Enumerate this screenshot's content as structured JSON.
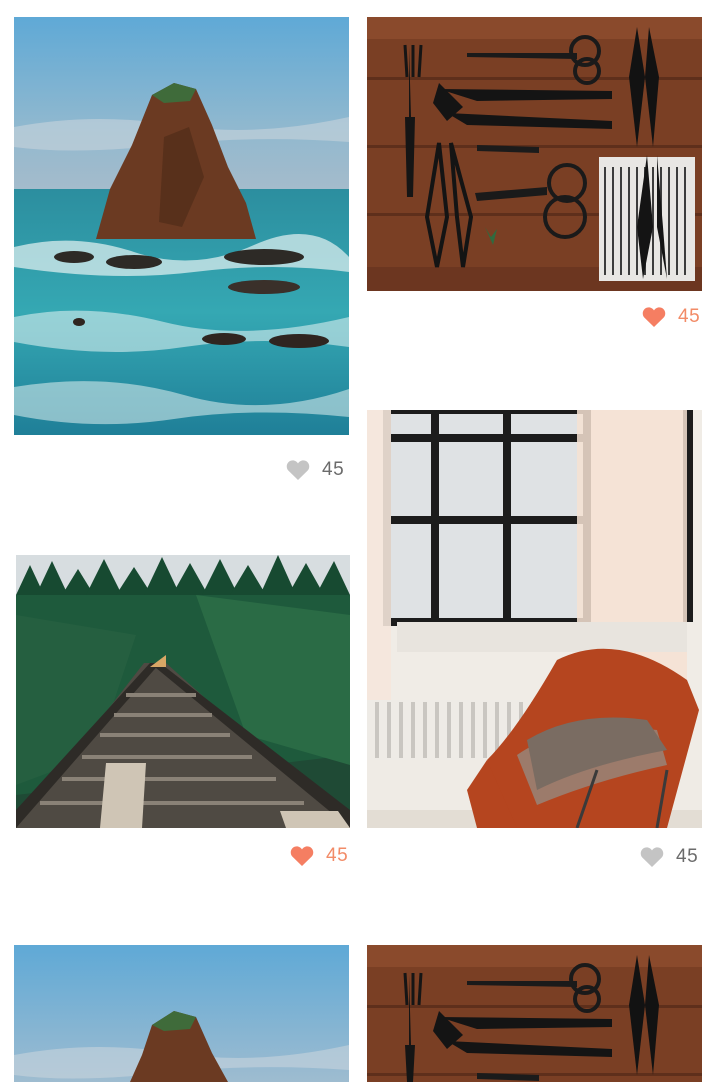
{
  "colors": {
    "liked": "#f57e62",
    "unliked": "#c4c4c4",
    "liked_text": "#f28b67",
    "unliked_text": "#6b6b6b"
  },
  "feed": {
    "items": [
      {
        "image": "sea-stack-photo",
        "liked": false,
        "like_count": "45"
      },
      {
        "image": "garden-tools-photo",
        "liked": true,
        "like_count": "45"
      },
      {
        "image": "railway-bridge-forest-photo",
        "liked": true,
        "like_count": "45"
      },
      {
        "image": "butterfly-chair-window-photo",
        "liked": false,
        "like_count": "45"
      },
      {
        "image": "sea-stack-photo",
        "liked": null,
        "like_count": null
      },
      {
        "image": "garden-tools-photo",
        "liked": null,
        "like_count": null
      }
    ]
  }
}
